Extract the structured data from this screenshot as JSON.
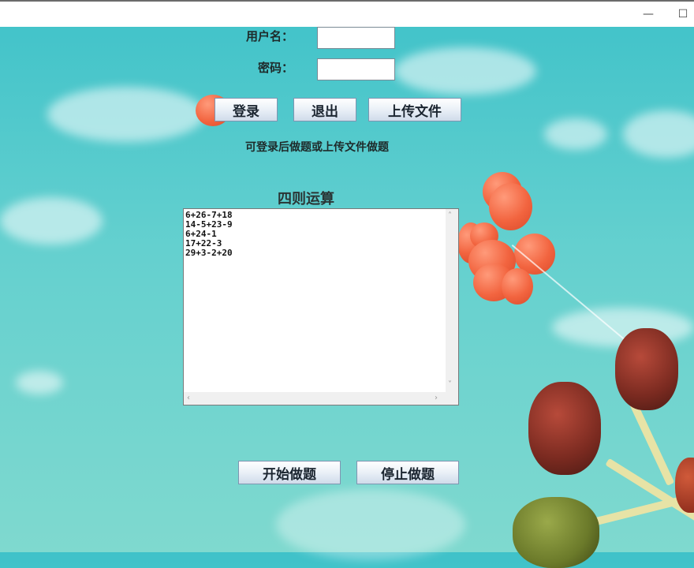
{
  "window": {
    "minimize": "—",
    "maximize": "☐"
  },
  "login": {
    "username_label": "用户名：",
    "password_label": "密码：",
    "username_value": "",
    "password_value": "",
    "login_button": "登录",
    "exit_button": "退出",
    "upload_button": "上传文件",
    "hint": "可登录后做题或上传文件做题"
  },
  "exercise": {
    "title": "四则运算",
    "lines": [
      "6+26-7+18",
      "14-5+23-9",
      "6+24-1",
      "17+22-3",
      "29+3-2+20"
    ],
    "start_button": "开始做题",
    "stop_button": "停止做题"
  },
  "colors": {
    "background_top": "#3fc2c9",
    "background_bottom": "#7fd9cf",
    "balloon": "#f2643f",
    "button_border": "#7f95b1"
  }
}
